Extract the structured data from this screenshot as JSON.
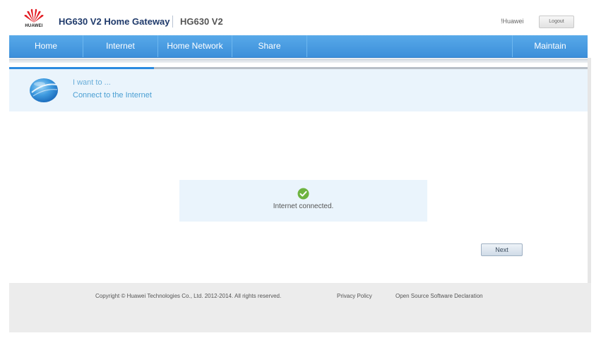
{
  "header": {
    "logo_text": "HUAWEI",
    "product_title": "HG630 V2 Home Gateway",
    "model_title": "HG630 V2",
    "user": "!Huawei",
    "logout_label": "Logout"
  },
  "nav": {
    "items": [
      {
        "label": "Home"
      },
      {
        "label": "Internet"
      },
      {
        "label": "Home Network"
      },
      {
        "label": "Share"
      },
      {
        "label": "Maintain"
      }
    ]
  },
  "wizard": {
    "progress_fraction": 0.25,
    "want_to": "I want to ...",
    "title": "Connect to the Internet"
  },
  "status": {
    "message": "Internet connected.",
    "icon": "check-circle-icon"
  },
  "actions": {
    "next_label": "Next"
  },
  "footer": {
    "copyright": "Copyright © Huawei Technologies Co., Ltd. 2012-2014. All rights reserved.",
    "privacy": "Privacy Policy",
    "open_source": "Open Source Software Declaration"
  },
  "colors": {
    "brand_red": "#e21a22",
    "nav_blue": "#3c8fda",
    "panel_bg": "#eaf4fc",
    "success_green": "#6db33f"
  }
}
